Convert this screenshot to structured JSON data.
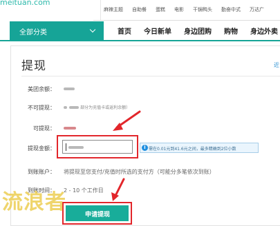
{
  "site": {
    "logo": "meituan.com"
  },
  "sub_links": [
    "麻辣主题",
    "自助餐",
    "蛋糕",
    "电影",
    "干锅鸭头",
    "勤奋中式",
    "万达广"
  ],
  "nav": {
    "category_button": "全部分类",
    "items": [
      "首页",
      "今日新单",
      "身边团购",
      "购物",
      "身边外卖"
    ]
  },
  "page": {
    "title": "提现",
    "side_link": "近"
  },
  "form": {
    "balance_label": "美团余额：",
    "non_withdrawable_label": "不可提现：",
    "non_withdrawable_note": "部分为充值卡或返利余额）",
    "withdrawable_label": "可提现：",
    "amount_label": "提现金额：",
    "amount_tip": "需在0.01元到41.6元之间，最多精确到2位小数",
    "account_label": "到账账户：",
    "account_text": "将提现至您支付/充值时所选的支付方（可能分多笔依次到账）",
    "time_label": "到账时间：",
    "time_value": "2 - 10 个工作日",
    "submit_label": "申请提现"
  },
  "watermark": "流浪者",
  "colors": {
    "brand": "#16a497",
    "button": "#18ad9a",
    "annotation": "#e2262b",
    "tip_bg": "#eaf5fd",
    "watermark": "#ecce54"
  },
  "icons": [
    "chevron-down-icon",
    "info-icon",
    "annotation-arrow"
  ]
}
